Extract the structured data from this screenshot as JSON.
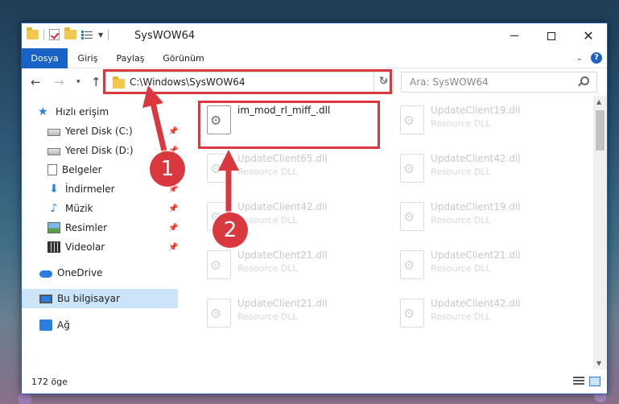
{
  "window": {
    "title": "SysWOW64",
    "ribbon_tabs": [
      "Dosya",
      "Giriş",
      "Paylaş",
      "Görünüm"
    ],
    "help": "?"
  },
  "address_bar": {
    "path": "C:\\Windows\\SysWOW64"
  },
  "search": {
    "placeholder": "Ara: SysWOW64"
  },
  "sidebar": {
    "items": [
      {
        "label": "Hızlı erişim",
        "icon": "star-icon"
      },
      {
        "label": "Yerel Disk (C:)",
        "icon": "drive-icon",
        "pinned": true
      },
      {
        "label": "Yerel Disk (D:)",
        "icon": "drive-icon",
        "pinned": true
      },
      {
        "label": "Belgeler",
        "icon": "documents-icon",
        "pinned": true
      },
      {
        "label": "İndirmeler",
        "icon": "download-icon",
        "pinned": true
      },
      {
        "label": "Müzik",
        "icon": "music-icon",
        "pinned": true
      },
      {
        "label": "Resimler",
        "icon": "pictures-icon",
        "pinned": true
      },
      {
        "label": "Videolar",
        "icon": "videos-icon",
        "pinned": true
      },
      {
        "label": "OneDrive",
        "icon": "cloud-icon"
      },
      {
        "label": "Bu bilgisayar",
        "icon": "computer-icon",
        "selected": true
      },
      {
        "label": "Ağ",
        "icon": "network-icon"
      }
    ]
  },
  "files": [
    {
      "name": "im_mod_rl_miff_.dll",
      "type": "",
      "highlighted": true
    },
    {
      "name": "UpdateClient19.dll",
      "type": "Resource DLL"
    },
    {
      "name": "UpdateClient65.dll",
      "type": "Resource DLL"
    },
    {
      "name": "UpdateClient42.dll",
      "type": "Resource DLL"
    },
    {
      "name": "UpdateClient42.dll",
      "type": "Resource DLL"
    },
    {
      "name": "UpdateClient19.dll",
      "type": "Resource DLL"
    },
    {
      "name": "UpdateClient21.dll",
      "type": "Resource DLL"
    },
    {
      "name": "UpdateClient21.dll",
      "type": "Resource DLL"
    },
    {
      "name": "UpdateClient21.dll",
      "type": "Resource DLL"
    },
    {
      "name": "UpdateClient42.dll",
      "type": "Resource DLL"
    }
  ],
  "status": {
    "item_count": "172 öge"
  },
  "annotations": {
    "step1": "1",
    "step2": "2",
    "accent": "#d9383f"
  }
}
